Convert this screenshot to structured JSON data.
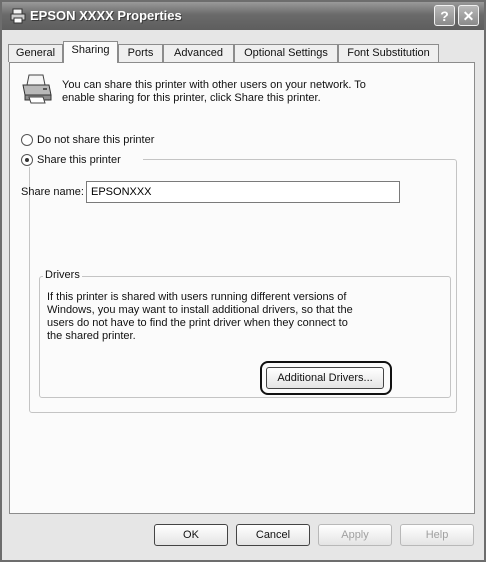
{
  "window": {
    "title": "EPSON XXXX Properties",
    "help_label": "?",
    "close_label": "✕"
  },
  "tabs": [
    {
      "label": "General"
    },
    {
      "label": "Sharing"
    },
    {
      "label": "Ports"
    },
    {
      "label": "Advanced"
    },
    {
      "label": "Optional Settings"
    },
    {
      "label": "Font Substitution"
    }
  ],
  "sharing": {
    "intro_line1": "You can share this printer with other users on your network.  To",
    "intro_line2": "enable sharing for this printer, click Share this printer.",
    "radio_not_share": "Do not share this printer",
    "radio_share": "Share this printer",
    "selected": "Share this printer",
    "share_name_label": "Share name:",
    "share_name_value": "EPSONXXX"
  },
  "drivers": {
    "legend": "Drivers",
    "line1": "If this printer is shared with users running different versions of",
    "line2": "Windows, you may want to install additional drivers, so that the",
    "line3": "users do not have to find the print driver when they connect to",
    "line4": "the shared printer.",
    "button_label": "Additional Drivers..."
  },
  "footer": {
    "ok_label": "OK",
    "cancel_label": "Cancel",
    "apply_label": "Apply",
    "help_label": "Help"
  },
  "icons": [
    "printer-icon",
    "help-icon",
    "close-icon",
    "window-printer-icon"
  ]
}
